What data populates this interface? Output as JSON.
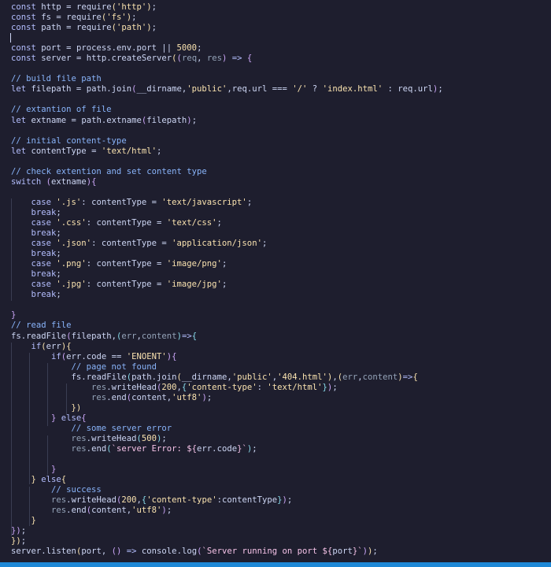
{
  "editor": {
    "lines": [
      [
        [
          "const ",
          "k"
        ],
        [
          "http",
          "d"
        ],
        [
          " = ",
          "p"
        ],
        [
          "require",
          "f"
        ],
        [
          "(",
          "y"
        ],
        [
          "'http'",
          "s"
        ],
        [
          ")",
          "y"
        ],
        [
          ";",
          "p"
        ]
      ],
      [
        [
          "const ",
          "k"
        ],
        [
          "fs",
          "d"
        ],
        [
          " = ",
          "p"
        ],
        [
          "require",
          "f"
        ],
        [
          "(",
          "y"
        ],
        [
          "'fs'",
          "s"
        ],
        [
          ")",
          "y"
        ],
        [
          ";",
          "p"
        ]
      ],
      [
        [
          "const ",
          "k"
        ],
        [
          "path",
          "d"
        ],
        [
          " = ",
          "p"
        ],
        [
          "require",
          "f"
        ],
        [
          "(",
          "y"
        ],
        [
          "'path'",
          "s"
        ],
        [
          ")",
          "y"
        ],
        [
          ";",
          "p"
        ]
      ],
      [],
      [
        [
          "const ",
          "k"
        ],
        [
          "port",
          "d"
        ],
        [
          " = ",
          "p"
        ],
        [
          "process",
          "d"
        ],
        [
          ".",
          "p"
        ],
        [
          "env",
          "d"
        ],
        [
          ".",
          "p"
        ],
        [
          "port",
          "d"
        ],
        [
          " || ",
          "p"
        ],
        [
          "5000",
          "n"
        ],
        [
          ";",
          "p"
        ]
      ],
      [
        [
          "const ",
          "k"
        ],
        [
          "server",
          "d"
        ],
        [
          " = ",
          "p"
        ],
        [
          "http",
          "d"
        ],
        [
          ".",
          "p"
        ],
        [
          "createServer",
          "f"
        ],
        [
          "(",
          "y"
        ],
        [
          "(",
          "m"
        ],
        [
          "req",
          "g"
        ],
        [
          ", ",
          "p"
        ],
        [
          "res",
          "g"
        ],
        [
          ")",
          "m"
        ],
        [
          " => ",
          "k"
        ],
        [
          "{",
          "m"
        ]
      ],
      [],
      [
        [
          "// build file path",
          "c"
        ]
      ],
      [
        [
          "let ",
          "k"
        ],
        [
          "filepath",
          "d"
        ],
        [
          " = ",
          "p"
        ],
        [
          "path",
          "d"
        ],
        [
          ".",
          "p"
        ],
        [
          "join",
          "f"
        ],
        [
          "(",
          "m"
        ],
        [
          "__dirname",
          "d"
        ],
        [
          ",",
          "p"
        ],
        [
          "'public'",
          "s"
        ],
        [
          ",",
          "p"
        ],
        [
          "req",
          "d"
        ],
        [
          ".",
          "p"
        ],
        [
          "url",
          "d"
        ],
        [
          " === ",
          "p"
        ],
        [
          "'/'",
          "s"
        ],
        [
          " ? ",
          "p"
        ],
        [
          "'index.html'",
          "s"
        ],
        [
          " : ",
          "p"
        ],
        [
          "req",
          "d"
        ],
        [
          ".",
          "p"
        ],
        [
          "url",
          "d"
        ],
        [
          ")",
          "m"
        ],
        [
          ";",
          "p"
        ]
      ],
      [],
      [
        [
          "// extantion of file",
          "c"
        ]
      ],
      [
        [
          "let ",
          "k"
        ],
        [
          "extname",
          "d"
        ],
        [
          " = ",
          "p"
        ],
        [
          "path",
          "d"
        ],
        [
          ".",
          "p"
        ],
        [
          "extname",
          "f"
        ],
        [
          "(",
          "m"
        ],
        [
          "filepath",
          "d"
        ],
        [
          ")",
          "m"
        ],
        [
          ";",
          "p"
        ]
      ],
      [],
      [
        [
          "// initial content-type",
          "c"
        ]
      ],
      [
        [
          "let ",
          "k"
        ],
        [
          "contentType",
          "d"
        ],
        [
          " = ",
          "p"
        ],
        [
          "'text/html'",
          "s"
        ],
        [
          ";",
          "p"
        ]
      ],
      [],
      [
        [
          "// check extention and set content type",
          "c"
        ]
      ],
      [
        [
          "switch ",
          "k"
        ],
        [
          "(",
          "m"
        ],
        [
          "extname",
          "d"
        ],
        [
          ")",
          "m"
        ],
        [
          "{",
          "m"
        ]
      ],
      [],
      [
        [
          "    case ",
          "k"
        ],
        [
          "'.js'",
          "s"
        ],
        [
          ": ",
          "p"
        ],
        [
          "contentType",
          "d"
        ],
        [
          " = ",
          "p"
        ],
        [
          "'text/javascript'",
          "s"
        ],
        [
          ";",
          "p"
        ]
      ],
      [
        [
          "    break",
          "k"
        ],
        [
          ";",
          "p"
        ]
      ],
      [
        [
          "    case ",
          "k"
        ],
        [
          "'.css'",
          "s"
        ],
        [
          ": ",
          "p"
        ],
        [
          "contentType",
          "d"
        ],
        [
          " = ",
          "p"
        ],
        [
          "'text/css'",
          "s"
        ],
        [
          ";",
          "p"
        ]
      ],
      [
        [
          "    break",
          "k"
        ],
        [
          ";",
          "p"
        ]
      ],
      [
        [
          "    case ",
          "k"
        ],
        [
          "'.json'",
          "s"
        ],
        [
          ": ",
          "p"
        ],
        [
          "contentType",
          "d"
        ],
        [
          " = ",
          "p"
        ],
        [
          "'application/json'",
          "s"
        ],
        [
          ";",
          "p"
        ]
      ],
      [
        [
          "    break",
          "k"
        ],
        [
          ";",
          "p"
        ]
      ],
      [
        [
          "    case ",
          "k"
        ],
        [
          "'.png'",
          "s"
        ],
        [
          ": ",
          "p"
        ],
        [
          "contentType",
          "d"
        ],
        [
          " = ",
          "p"
        ],
        [
          "'image/png'",
          "s"
        ],
        [
          ";",
          "p"
        ]
      ],
      [
        [
          "    break",
          "k"
        ],
        [
          ";",
          "p"
        ]
      ],
      [
        [
          "    case ",
          "k"
        ],
        [
          "'.jpg'",
          "s"
        ],
        [
          ": ",
          "p"
        ],
        [
          "contentType",
          "d"
        ],
        [
          " = ",
          "p"
        ],
        [
          "'image/jpg'",
          "s"
        ],
        [
          ";",
          "p"
        ]
      ],
      [
        [
          "    break",
          "k"
        ],
        [
          ";",
          "p"
        ]
      ],
      [],
      [
        [
          "}",
          "m"
        ]
      ],
      [
        [
          "// read file",
          "c"
        ]
      ],
      [
        [
          "fs",
          "d"
        ],
        [
          ".",
          "p"
        ],
        [
          "readFile",
          "f"
        ],
        [
          "(",
          "m"
        ],
        [
          "filepath",
          "d"
        ],
        [
          ",",
          "p"
        ],
        [
          "(",
          "a"
        ],
        [
          "err",
          "g"
        ],
        [
          ",",
          "p"
        ],
        [
          "content",
          "g"
        ],
        [
          ")",
          "a"
        ],
        [
          "=>",
          "k"
        ],
        [
          "{",
          "a"
        ]
      ],
      [
        [
          "    if",
          "k"
        ],
        [
          "(",
          "y"
        ],
        [
          "err",
          "d"
        ],
        [
          ")",
          "y"
        ],
        [
          "{",
          "y"
        ]
      ],
      [
        [
          "        if",
          "k"
        ],
        [
          "(",
          "m"
        ],
        [
          "err",
          "d"
        ],
        [
          ".",
          "p"
        ],
        [
          "code",
          "d"
        ],
        [
          " == ",
          "p"
        ],
        [
          "'ENOENT'",
          "s"
        ],
        [
          ")",
          "m"
        ],
        [
          "{",
          "m"
        ]
      ],
      [
        [
          "            // page not found",
          "c"
        ]
      ],
      [
        [
          "            fs",
          "d"
        ],
        [
          ".",
          "p"
        ],
        [
          "readFile",
          "f"
        ],
        [
          "(",
          "a"
        ],
        [
          "path",
          "d"
        ],
        [
          ".",
          "p"
        ],
        [
          "join",
          "f"
        ],
        [
          "(",
          "y"
        ],
        [
          "__dirname",
          "d"
        ],
        [
          ",",
          "p"
        ],
        [
          "'public'",
          "s"
        ],
        [
          ",",
          "p"
        ],
        [
          "'404.html'",
          "s"
        ],
        [
          ")",
          "y"
        ],
        [
          ",",
          "p"
        ],
        [
          "(",
          "y"
        ],
        [
          "err",
          "g"
        ],
        [
          ",",
          "p"
        ],
        [
          "content",
          "g"
        ],
        [
          ")",
          "y"
        ],
        [
          "=>",
          "k"
        ],
        [
          "{",
          "y"
        ]
      ],
      [
        [
          "                res",
          "g"
        ],
        [
          ".",
          "p"
        ],
        [
          "writeHead",
          "f"
        ],
        [
          "(",
          "m"
        ],
        [
          "200",
          "n"
        ],
        [
          ",",
          "p"
        ],
        [
          "{",
          "a"
        ],
        [
          "'content-type'",
          "s"
        ],
        [
          ": ",
          "p"
        ],
        [
          "'text/html'",
          "s"
        ],
        [
          "}",
          "a"
        ],
        [
          ")",
          "m"
        ],
        [
          ";",
          "p"
        ]
      ],
      [
        [
          "                res",
          "g"
        ],
        [
          ".",
          "p"
        ],
        [
          "end",
          "f"
        ],
        [
          "(",
          "m"
        ],
        [
          "content",
          "d"
        ],
        [
          ",",
          "p"
        ],
        [
          "'utf8'",
          "s"
        ],
        [
          ")",
          "m"
        ],
        [
          ";",
          "p"
        ]
      ],
      [
        [
          "            })",
          "y"
        ]
      ],
      [
        [
          "        } ",
          "m"
        ],
        [
          "else",
          "k"
        ],
        [
          "{",
          "m"
        ]
      ],
      [
        [
          "            // some server error",
          "c"
        ]
      ],
      [
        [
          "            res",
          "g"
        ],
        [
          ".",
          "p"
        ],
        [
          "writeHead",
          "f"
        ],
        [
          "(",
          "a"
        ],
        [
          "500",
          "n"
        ],
        [
          ")",
          "a"
        ],
        [
          ";",
          "p"
        ]
      ],
      [
        [
          "            res",
          "g"
        ],
        [
          ".",
          "p"
        ],
        [
          "end",
          "f"
        ],
        [
          "(",
          "a"
        ],
        [
          "`server Error: ${",
          "t"
        ],
        [
          "err",
          "d"
        ],
        [
          ".",
          "p"
        ],
        [
          "code",
          "d"
        ],
        [
          "}`",
          "t"
        ],
        [
          ")",
          "a"
        ],
        [
          ";",
          "p"
        ]
      ],
      [],
      [
        [
          "        }",
          "m"
        ]
      ],
      [
        [
          "    } ",
          "y"
        ],
        [
          "else",
          "k"
        ],
        [
          "{",
          "y"
        ]
      ],
      [
        [
          "        // success",
          "c"
        ]
      ],
      [
        [
          "        res",
          "g"
        ],
        [
          ".",
          "p"
        ],
        [
          "writeHead",
          "f"
        ],
        [
          "(",
          "m"
        ],
        [
          "200",
          "n"
        ],
        [
          ",",
          "p"
        ],
        [
          "{",
          "a"
        ],
        [
          "'content-type'",
          "s"
        ],
        [
          ":",
          "p"
        ],
        [
          "contentType",
          "d"
        ],
        [
          "}",
          "a"
        ],
        [
          ")",
          "m"
        ],
        [
          ";",
          "p"
        ]
      ],
      [
        [
          "        res",
          "g"
        ],
        [
          ".",
          "p"
        ],
        [
          "end",
          "f"
        ],
        [
          "(",
          "m"
        ],
        [
          "content",
          "d"
        ],
        [
          ",",
          "p"
        ],
        [
          "'utf8'",
          "s"
        ],
        [
          ")",
          "m"
        ],
        [
          ";",
          "p"
        ]
      ],
      [
        [
          "    }",
          "y"
        ]
      ],
      [
        [
          "})",
          "m"
        ],
        [
          ";",
          "p"
        ]
      ],
      [
        [
          "})",
          "y"
        ],
        [
          ";",
          "p"
        ]
      ],
      [
        [
          "server",
          "d"
        ],
        [
          ".",
          "p"
        ],
        [
          "listen",
          "f"
        ],
        [
          "(",
          "y"
        ],
        [
          "port",
          "d"
        ],
        [
          ", ",
          "p"
        ],
        [
          "()",
          "m"
        ],
        [
          " => ",
          "k"
        ],
        [
          "console",
          "d"
        ],
        [
          ".",
          "p"
        ],
        [
          "log",
          "f"
        ],
        [
          "(",
          "m"
        ],
        [
          "`Server running on port ${",
          "t"
        ],
        [
          "port",
          "d"
        ],
        [
          "}`",
          "t"
        ],
        [
          ")",
          "m"
        ],
        [
          ")",
          "y"
        ],
        [
          ";",
          "p"
        ]
      ]
    ]
  },
  "colors": {
    "background": "#1e1e2e",
    "status_bar": "#1e88d6"
  }
}
